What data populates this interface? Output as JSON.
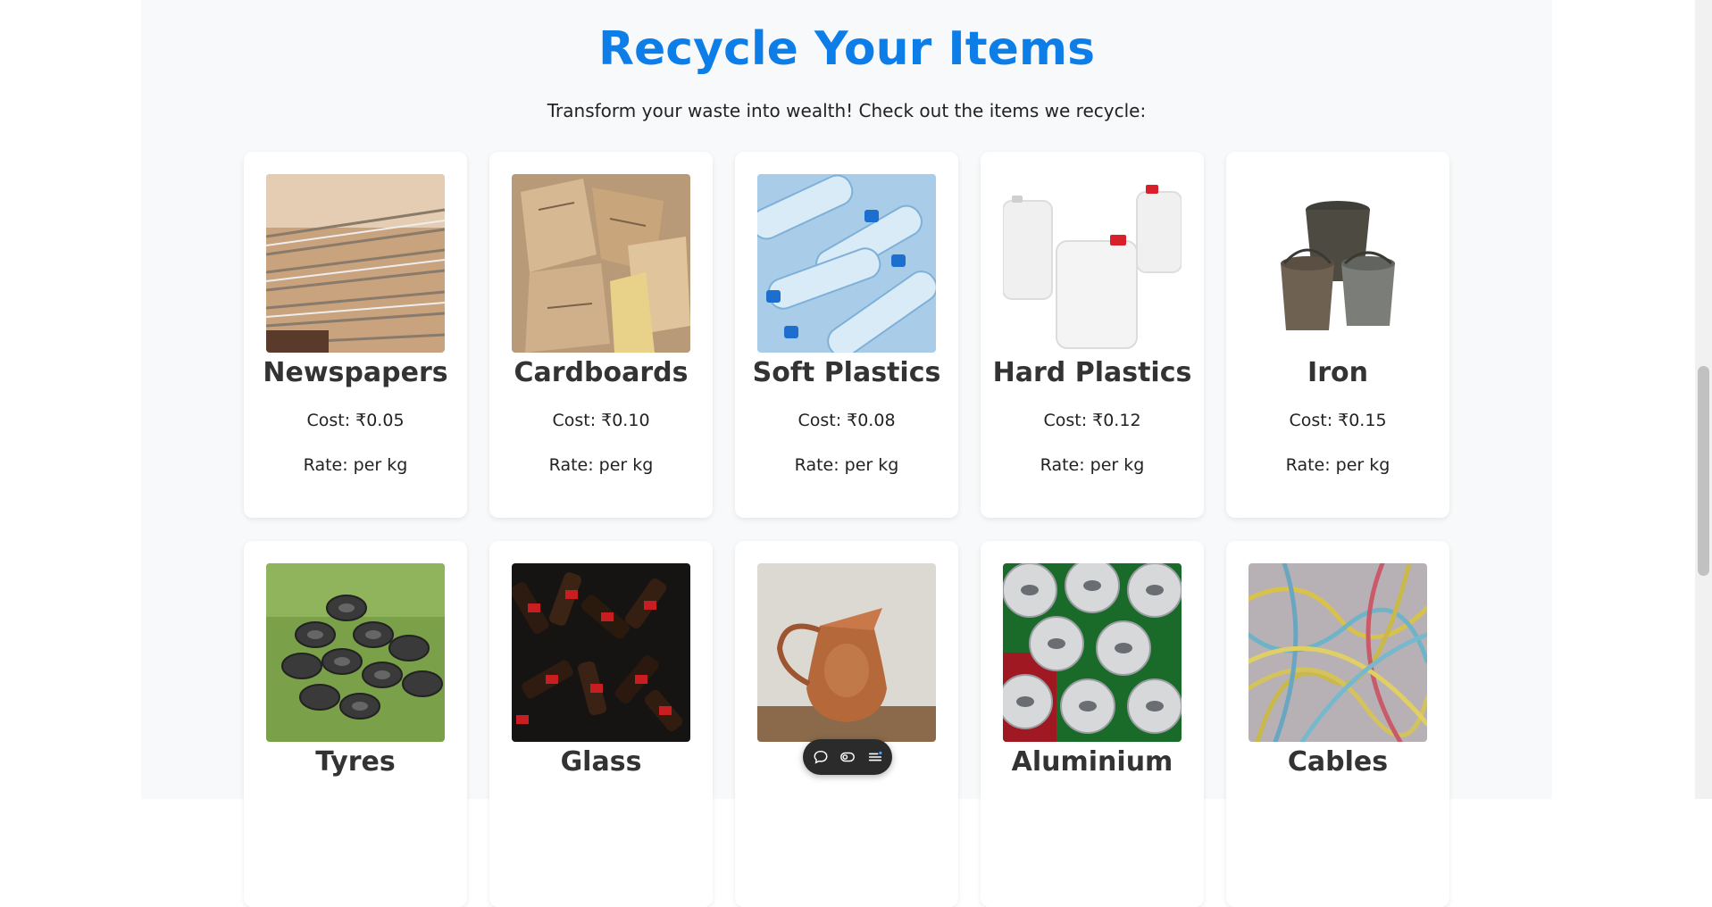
{
  "header": {
    "title": "Recycle Your Items",
    "subtitle": "Transform your waste into wealth! Check out the items we recycle:"
  },
  "colors": {
    "title": "#0d7ee8",
    "background": "#f8f9fa",
    "card": "#ffffff"
  },
  "items": [
    {
      "name": "Newspapers",
      "cost": "Cost: ₹0.05",
      "rate": "Rate: per kg"
    },
    {
      "name": "Cardboards",
      "cost": "Cost: ₹0.10",
      "rate": "Rate: per kg"
    },
    {
      "name": "Soft Plastics",
      "cost": "Cost: ₹0.08",
      "rate": "Rate: per kg"
    },
    {
      "name": "Hard Plastics",
      "cost": "Cost: ₹0.12",
      "rate": "Rate: per kg"
    },
    {
      "name": "Iron",
      "cost": "Cost: ₹0.15",
      "rate": "Rate: per kg"
    },
    {
      "name": "Tyres"
    },
    {
      "name": "Glass"
    },
    {
      "name": ""
    },
    {
      "name": "Aluminium"
    },
    {
      "name": "Cables"
    }
  ],
  "toolbar": {
    "icons": [
      "chat-bubble-icon",
      "toggle-icon",
      "menu-list-icon"
    ]
  }
}
